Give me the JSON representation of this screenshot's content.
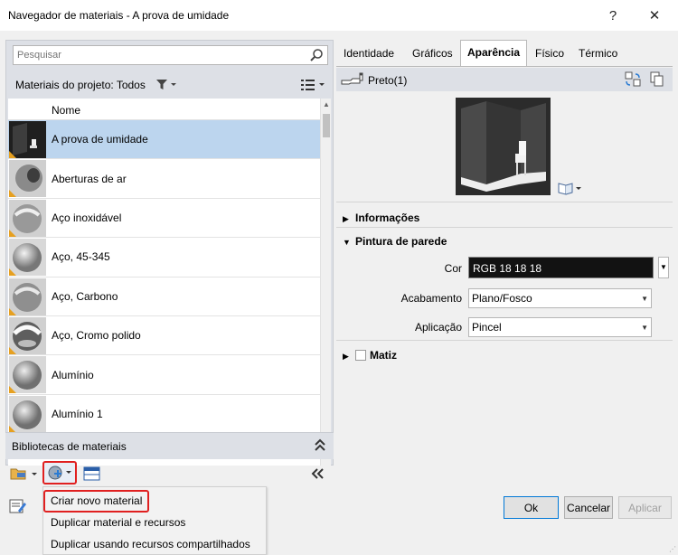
{
  "window": {
    "title": "Navegador de materiais - A prova de umidade",
    "help_label": "?",
    "close_label": "✕"
  },
  "search": {
    "placeholder": "Pesquisar"
  },
  "project": {
    "label": "Materiais do projeto: Todos"
  },
  "list": {
    "header": "Nome",
    "items": [
      {
        "label": "A prova de umidade",
        "selected": true,
        "thumb": "wall"
      },
      {
        "label": "Aberturas de ar",
        "thumb": "tube"
      },
      {
        "label": "Aço inoxidável",
        "thumb": "sphere-stripe"
      },
      {
        "label": "Aço, 45-345",
        "thumb": "sphere"
      },
      {
        "label": "Aço, Carbono",
        "thumb": "sphere-stripe"
      },
      {
        "label": "Aço, Cromo polido",
        "thumb": "sphere-chrome"
      },
      {
        "label": "Alumínio",
        "thumb": "sphere"
      },
      {
        "label": "Alumínio 1",
        "thumb": "sphere"
      }
    ]
  },
  "libraries": {
    "label": "Bibliotecas de materiais"
  },
  "menu": {
    "items": [
      "Criar novo material",
      "Duplicar material e recursos",
      "Duplicar usando recursos compartilhados"
    ]
  },
  "tabs": {
    "items": [
      "Identidade",
      "Gráficos",
      "Aparência",
      "Físico",
      "Térmico"
    ],
    "active": "Aparência"
  },
  "asset": {
    "name": "Preto(1)"
  },
  "sections": {
    "info": "Informações",
    "paint": "Pintura de parede",
    "matiz": "Matiz"
  },
  "props": {
    "cor_label": "Cor",
    "cor_value": "RGB 18 18 18",
    "acabamento_label": "Acabamento",
    "acabamento_value": "Plano/Fosco",
    "aplicacao_label": "Aplicação",
    "aplicacao_value": "Pincel"
  },
  "buttons": {
    "ok": "Ok",
    "cancel": "Cancelar",
    "apply": "Aplicar"
  },
  "colors": {
    "selection": "#bcd5ee",
    "highlight_box": "#e02020",
    "swatch": "#121212"
  }
}
